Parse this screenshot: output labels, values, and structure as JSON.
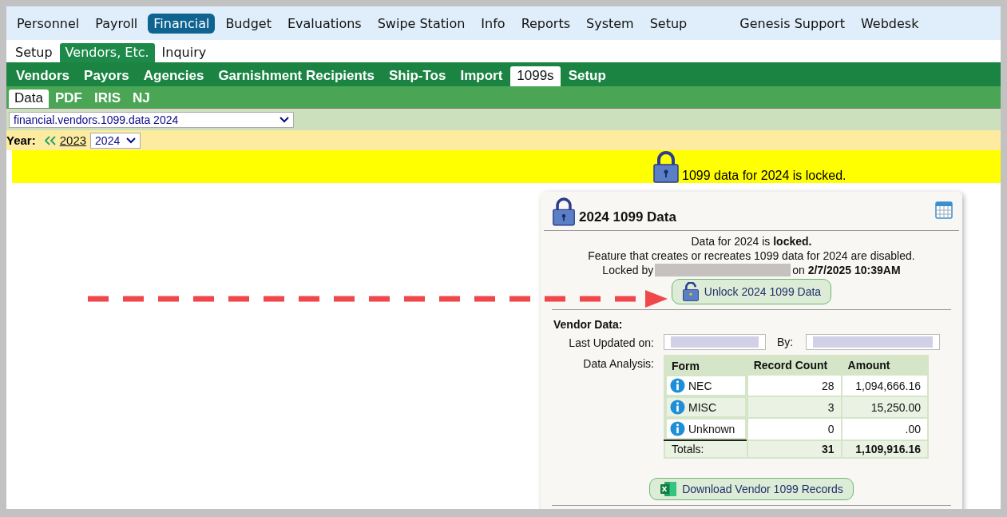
{
  "top_menu": [
    {
      "label": "Personnel",
      "selected": false
    },
    {
      "label": "Payroll",
      "selected": false
    },
    {
      "label": "Financial",
      "selected": true
    },
    {
      "label": "Budget",
      "selected": false
    },
    {
      "label": "Evaluations",
      "selected": false
    },
    {
      "label": "Swipe Station",
      "selected": false
    },
    {
      "label": "Info",
      "selected": false
    },
    {
      "label": "Reports",
      "selected": false
    },
    {
      "label": "System",
      "selected": false
    },
    {
      "label": "Setup",
      "selected": false
    }
  ],
  "top_menu_right": [
    "Genesis Support",
    "Webdesk"
  ],
  "sub_menu": [
    {
      "label": "Setup",
      "selected": false
    },
    {
      "label": "Vendors, Etc.",
      "selected": true
    },
    {
      "label": "Inquiry",
      "selected": false
    }
  ],
  "section_tabs": [
    {
      "label": "Vendors",
      "selected": false
    },
    {
      "label": "Payors",
      "selected": false
    },
    {
      "label": "Agencies",
      "selected": false
    },
    {
      "label": "Garnishment Recipients",
      "selected": false
    },
    {
      "label": "Ship-Tos",
      "selected": false
    },
    {
      "label": "Import",
      "selected": false
    },
    {
      "label": "1099s",
      "selected": true
    },
    {
      "label": "Setup",
      "selected": false
    }
  ],
  "page_tabs": [
    {
      "label": "Data",
      "selected": true
    },
    {
      "label": "PDF",
      "selected": false
    },
    {
      "label": "IRIS",
      "selected": false
    },
    {
      "label": "NJ",
      "selected": false
    }
  ],
  "page_select": {
    "value": "financial.vendors.1099.data 2024"
  },
  "year": {
    "label": "Year:",
    "previous": "2023",
    "value": "2024"
  },
  "banner": {
    "text": "1099 data for 2024 is locked."
  },
  "panel": {
    "title": "2024 1099 Data",
    "status": "Data for 2024 is **locked.**",
    "note": "Feature that creates or recreates 1099 data for 2024 are disabled.",
    "locked_by_label": "Locked by",
    "locked_on": "on **2/7/2025 10:39AM**",
    "unlock_button": "Unlock 2024 1099 Data",
    "vendor_heading": "Vendor Data:",
    "last_updated_label": "Last Updated on:",
    "by_label": "By:",
    "analysis_label": "Data Analysis:",
    "table": {
      "columns": [
        "Form",
        "Record Count",
        "Amount"
      ],
      "rows": [
        {
          "form": "NEC",
          "count": "28",
          "amount": "1,094,666.16"
        },
        {
          "form": "MISC",
          "count": "3",
          "amount": "15,250.00"
        },
        {
          "form": "Unknown",
          "count": "0",
          "amount": ".00"
        }
      ],
      "totals": {
        "label": "Totals:",
        "count": "31",
        "amount": "1,109,916.16"
      }
    },
    "download_button": "Download Vendor 1099 Records"
  }
}
